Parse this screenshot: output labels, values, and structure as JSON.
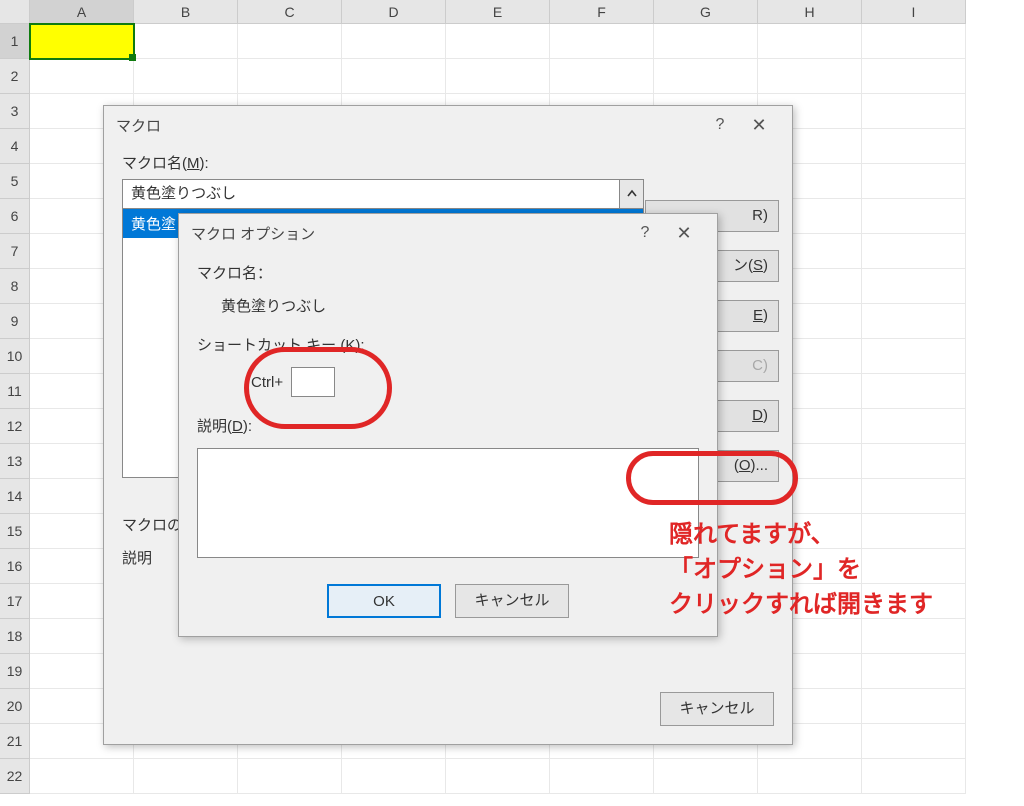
{
  "sheet": {
    "columns": [
      "A",
      "B",
      "C",
      "D",
      "E",
      "F",
      "G",
      "H",
      "I"
    ],
    "rows": [
      "1",
      "2",
      "3",
      "4",
      "5",
      "6",
      "7",
      "8",
      "9",
      "10",
      "11",
      "12",
      "13",
      "14",
      "15",
      "16",
      "17",
      "18",
      "19",
      "20",
      "21",
      "22"
    ]
  },
  "macro_dialog": {
    "title": "マクロ",
    "name_label_prefix": "マクロ名(",
    "name_label_key": "M",
    "name_label_suffix": "):",
    "name_value": "黄色塗りつぶし",
    "list_selected": "黄色塗",
    "buttons": {
      "run_suffix": "R)",
      "step_suffix_prefix": "ン(",
      "step_key": "S",
      "step_suffix_suffix": ")",
      "edit_key": "E",
      "edit_suffix": ")",
      "create_suffix": "C)",
      "delete_key": "D",
      "delete_suffix": ")",
      "options_key": "O",
      "options_suffix": ")..."
    },
    "location_label": "マクロの保",
    "description_label": "説明",
    "cancel": "キャンセル"
  },
  "options_dialog": {
    "title": "マクロ オプション",
    "name_label": "マクロ名：",
    "name_value": "黄色塗りつぶし",
    "shortcut_label_prefix": "ショートカット キー (",
    "shortcut_label_key": "K",
    "shortcut_label_suffix": "):",
    "shortcut_prefix": "Ctrl+",
    "shortcut_value": "",
    "desc_label_prefix": "説明(",
    "desc_label_key": "D",
    "desc_label_suffix": "):",
    "desc_value": "",
    "ok": "OK",
    "cancel": "キャンセル"
  },
  "annotation": {
    "line1": "隠れてますが、",
    "line2": "「オプション」を",
    "line3": "クリックすれば開きます"
  }
}
